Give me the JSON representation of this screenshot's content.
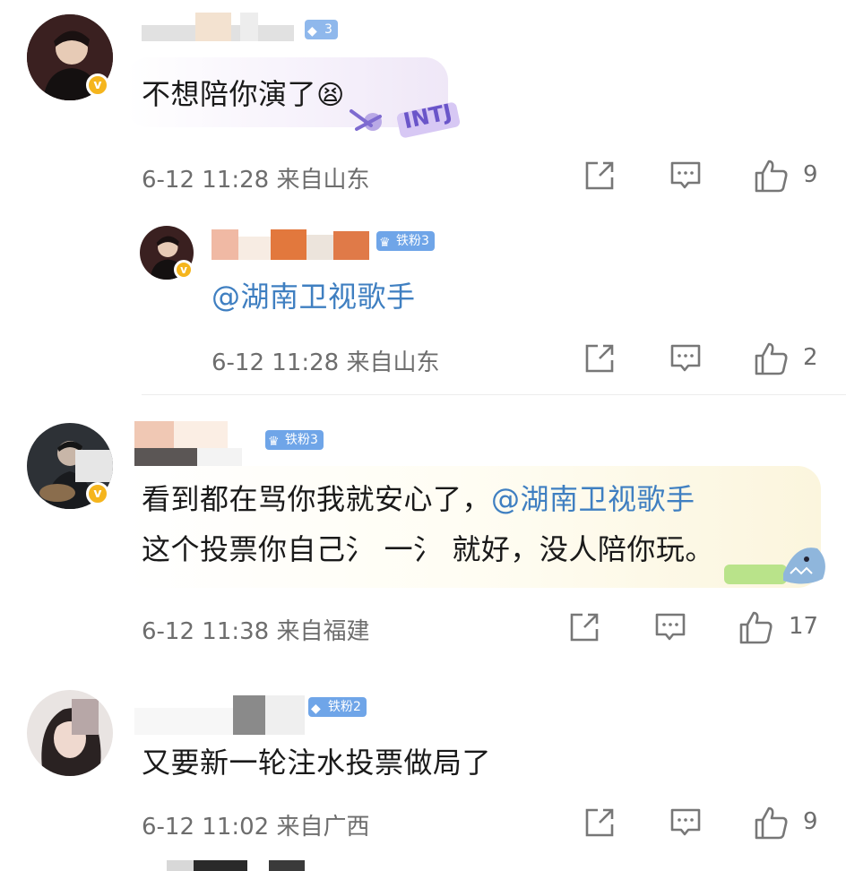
{
  "comments": [
    {
      "user_level": "3",
      "text": "不想陪你演了",
      "emoji": "😫",
      "sticker_text": "INTJ",
      "time": "6-12 11:28",
      "location": "来自山东",
      "likes": "9",
      "reply": {
        "fan_badge": "铁粉3",
        "mention": "@湖南卫视歌手",
        "time": "6-12 11:28",
        "location": "来自山东",
        "likes": "2"
      }
    },
    {
      "fan_badge": "铁粉3",
      "text_line1_prefix": "看到都在骂你我就安心了，",
      "mention": "@湖南卫视歌手",
      "text_line2": "这个投票你自己氵 一氵 就好，没人陪你玩。",
      "time": "6-12 11:38",
      "location": "来自福建",
      "likes": "17"
    },
    {
      "fan_badge": "铁粉2",
      "text": "又要新一轮注水投票做局了",
      "time": "6-12 11:02",
      "location": "来自广西",
      "likes": "9"
    }
  ],
  "badge_v": "v",
  "colors": {
    "mention": "#3f7fc1",
    "fan_badge": "#6fa5e8",
    "verified": "#f5b51d",
    "meta": "#6d6d6d"
  },
  "icons": [
    "share-icon",
    "comment-icon",
    "like-icon"
  ]
}
